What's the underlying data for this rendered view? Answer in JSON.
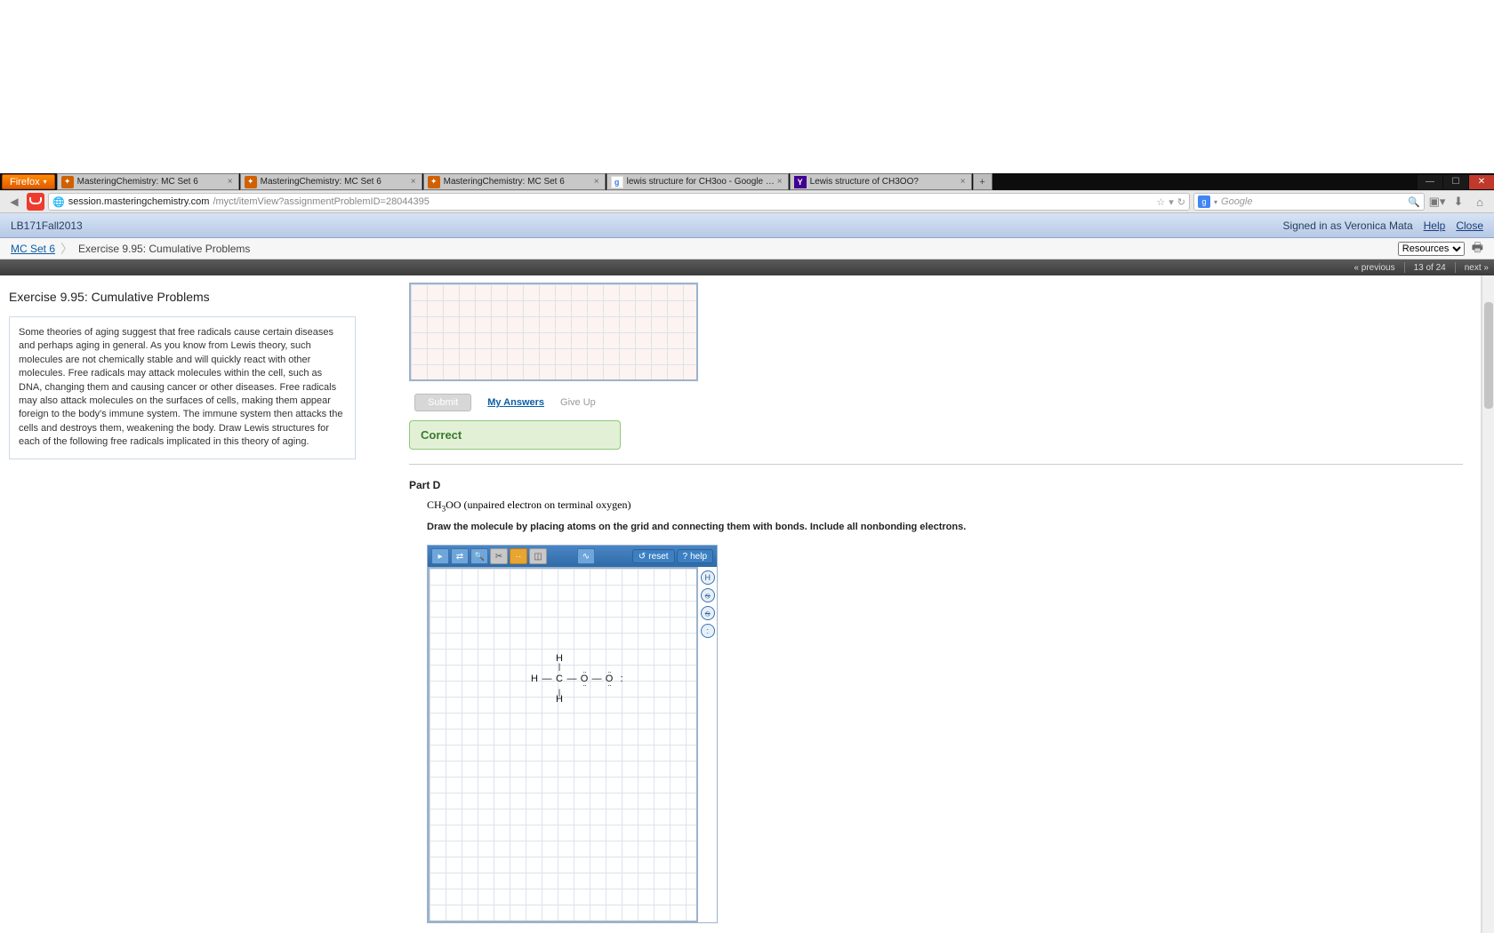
{
  "browser": {
    "menu_label": "Firefox",
    "tabs": [
      {
        "title": "MasteringChemistry: MC Set 6",
        "fav": "mc"
      },
      {
        "title": "MasteringChemistry: MC Set 6",
        "fav": "mc"
      },
      {
        "title": "MasteringChemistry: MC Set 6",
        "fav": "mc"
      },
      {
        "title": "lewis structure for CH3oo - Google Se...",
        "fav": "g"
      },
      {
        "title": "Lewis structure of CH3OO?",
        "fav": "y"
      }
    ],
    "url_host": "session.masteringchemistry.com",
    "url_path": "/myct/itemView?assignmentProblemID=28044395",
    "search_placeholder": "Google"
  },
  "header": {
    "course": "LB171Fall2013",
    "signed_in": "Signed in as Veronica Mata",
    "help": "Help",
    "close": "Close"
  },
  "breadcrumb": {
    "crumb1": "MC Set 6",
    "crumb2": "Exercise 9.95: Cumulative Problems",
    "resources_label": "Resources"
  },
  "subnav": {
    "prev": "« previous",
    "pos": "13 of 24",
    "next": "next »"
  },
  "left": {
    "title": "Exercise 9.95: Cumulative Problems",
    "desc": "Some theories of aging suggest that free radicals cause certain diseases and perhaps aging in general. As you know from Lewis theory, such molecules are not chemically stable and will quickly react with other molecules. Free radicals may attack molecules within the cell, such as DNA, changing them and causing cancer or other diseases. Free radicals may also attack molecules on the surfaces of cells, making them appear foreign to the body's immune system. The immune system then attacks the cells and destroys them, weakening the body. Draw Lewis structures for each of the following free radicals implicated in this theory of aging."
  },
  "main": {
    "submit": "Submit",
    "my_answers": "My Answers",
    "give_up": "Give Up",
    "correct": "Correct",
    "part_label": "Part D",
    "formula_prefix": "CH",
    "formula_sub": "3",
    "formula_suffix": "OO",
    "formula_note": " (unpaired electron on terminal oxygen)",
    "instruction": "Draw the molecule by placing atoms on the grid and connecting them with bonds. Include all nonbonding electrons.",
    "reset": "reset",
    "help": "help"
  }
}
